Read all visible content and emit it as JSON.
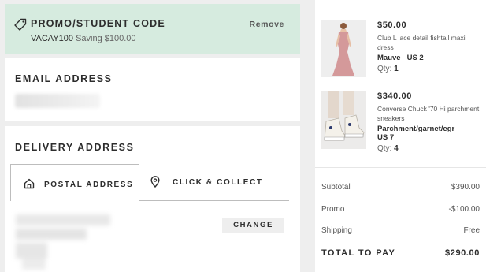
{
  "promo": {
    "title": "PROMO/STUDENT CODE",
    "remove_label": "Remove",
    "code": "VACAY100",
    "saving_text": "Saving $100.00",
    "background": "#d6ebdf"
  },
  "email": {
    "title": "EMAIL ADDRESS"
  },
  "delivery": {
    "title": "DELIVERY ADDRESS",
    "tabs": [
      {
        "label": "POSTAL ADDRESS",
        "icon": "home-icon",
        "active": true
      },
      {
        "label": "CLICK & COLLECT",
        "icon": "location-pin-icon",
        "active": false
      }
    ],
    "change_label": "CHANGE"
  },
  "bag": {
    "items": [
      {
        "price": "$50.00",
        "name": "Club L lace detail fishtail maxi dress",
        "color": "Mauve",
        "size": "US 2",
        "qty_label": "Qty:",
        "qty": "1"
      },
      {
        "price": "$340.00",
        "name": "Converse Chuck '70 Hi parchment sneakers",
        "color": "Parchment/garnet/egr",
        "size": "US 7",
        "qty_label": "Qty:",
        "qty": "4"
      }
    ]
  },
  "summary": {
    "subtotal_label": "Subtotal",
    "subtotal_value": "$390.00",
    "promo_label": "Promo",
    "promo_value": "-$100.00",
    "shipping_label": "Shipping",
    "shipping_value": "Free",
    "total_label": "TOTAL TO PAY",
    "total_value": "$290.00"
  }
}
